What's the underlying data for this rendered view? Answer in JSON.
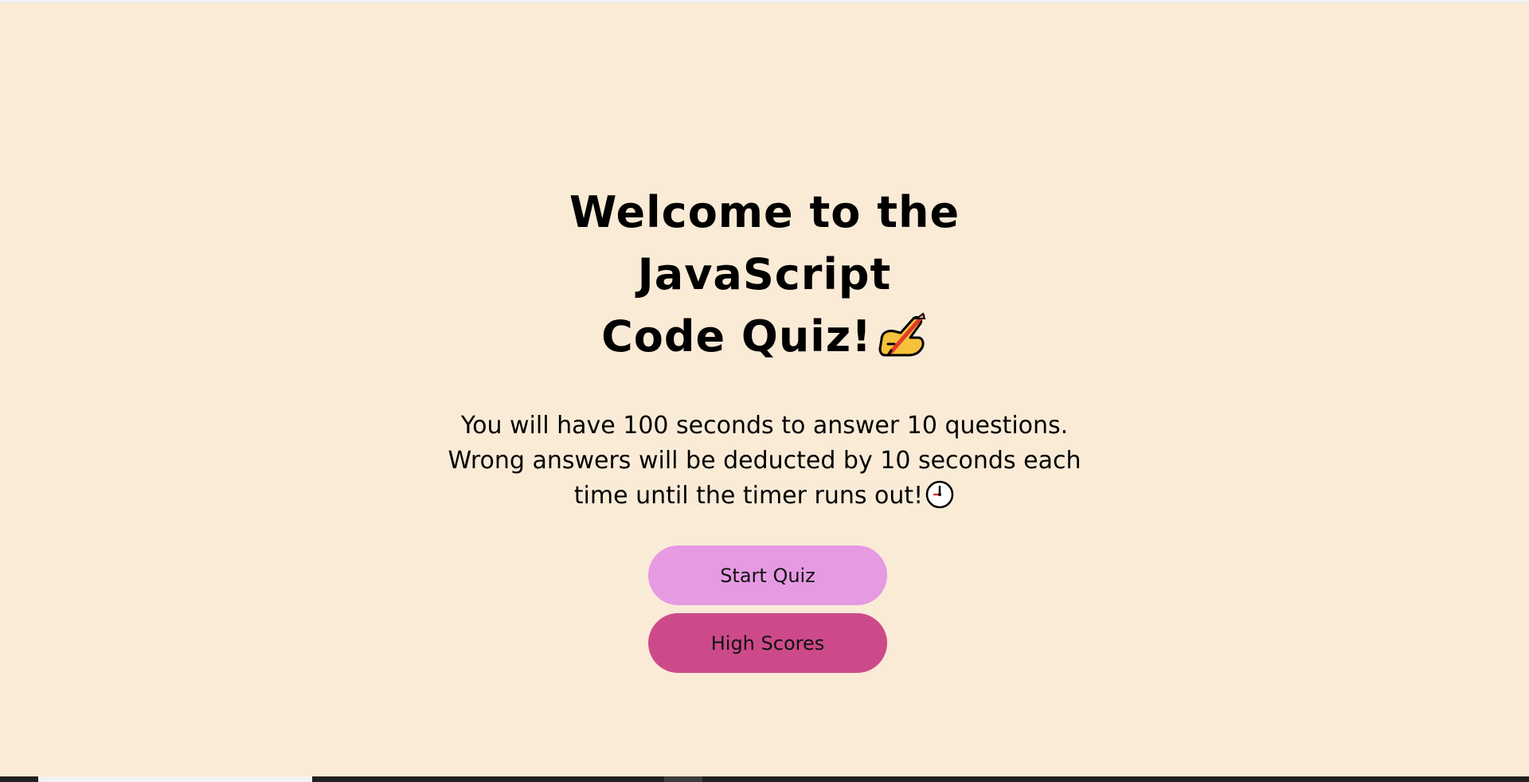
{
  "title": {
    "line1": "Welcome to the JavaScript",
    "line2": "Code Quiz!",
    "icon": "writing-hand-icon"
  },
  "description": {
    "text": "You will have 100 seconds to answer 10 questions. Wrong answers will be deducted by 10 seconds each time until the timer runs out!",
    "icon": "clock-icon"
  },
  "buttons": {
    "start_label": "Start Quiz",
    "high_scores_label": "High Scores"
  },
  "colors": {
    "background": "#faebd7",
    "start_button": "#e59ae2",
    "high_scores_button": "#cd4a8a",
    "taskbar": "#202020"
  }
}
